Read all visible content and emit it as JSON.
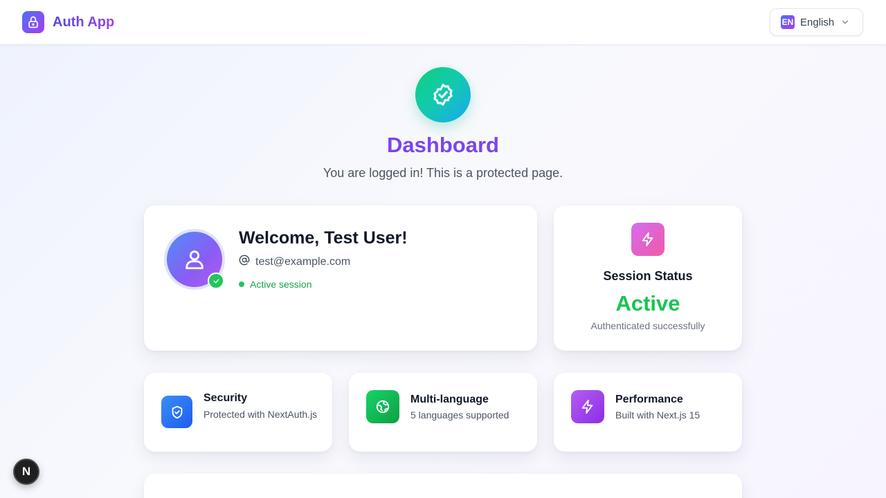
{
  "header": {
    "app_name": "Auth App",
    "language": {
      "code": "EN",
      "label": "English"
    }
  },
  "hero": {
    "title": "Dashboard",
    "subtitle": "You are logged in! This is a protected page."
  },
  "welcome": {
    "title": "Welcome, Test User!",
    "email": "test@example.com",
    "session": "Active session"
  },
  "status": {
    "label": "Session Status",
    "value": "Active",
    "description": "Authenticated successfully"
  },
  "features": [
    {
      "title": "Security",
      "description": "Protected with NextAuth.js",
      "icon": "shield-check-icon"
    },
    {
      "title": "Multi-language",
      "description": "5 languages supported",
      "icon": "globe-icon"
    },
    {
      "title": "Performance",
      "description": "Built with Next.js 15",
      "icon": "lightning-icon"
    }
  ],
  "dev_badge": {
    "letter": "N"
  },
  "colors": {
    "brand_start": "#4f6ef7",
    "brand_end": "#a43ff0",
    "title": "#7b45ec",
    "success": "#16c454"
  }
}
